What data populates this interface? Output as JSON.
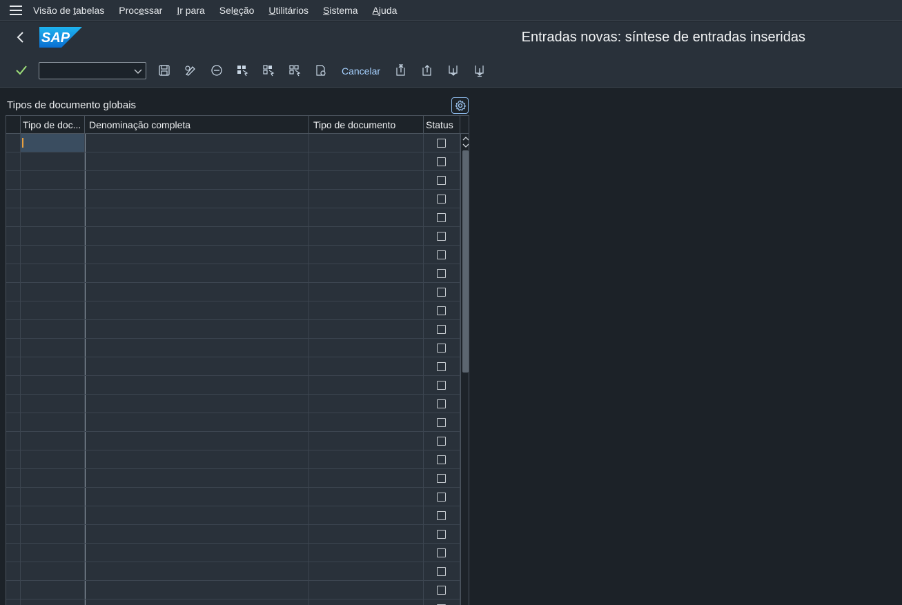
{
  "menubar": {
    "items": [
      {
        "pre": "Visão de ",
        "ul": "t",
        "post": "abelas"
      },
      {
        "pre": "Proc",
        "ul": "e",
        "post": "ssar"
      },
      {
        "pre": "",
        "ul": "I",
        "post": "r para"
      },
      {
        "pre": "Sel",
        "ul": "e",
        "post": "ção"
      },
      {
        "pre": "",
        "ul": "U",
        "post": "tilitários"
      },
      {
        "pre": "",
        "ul": "S",
        "post": "istema"
      },
      {
        "pre": "",
        "ul": "A",
        "post": "juda"
      }
    ]
  },
  "header": {
    "logo": "SAP",
    "title": "Entradas novas: síntese de entradas inseridas"
  },
  "toolbar": {
    "command_value": "",
    "cancel_label": "Cancelar"
  },
  "table": {
    "title": "Tipos de documento globais",
    "columns": [
      "Tipo de doc...",
      "Denominação completa",
      "Tipo de documento",
      "Status"
    ],
    "row_count": 26
  },
  "colors": {
    "shell": "#29313a",
    "background": "#1c2228",
    "accent": "#a6d1ff",
    "sap_blue": "#1a8fe3"
  }
}
